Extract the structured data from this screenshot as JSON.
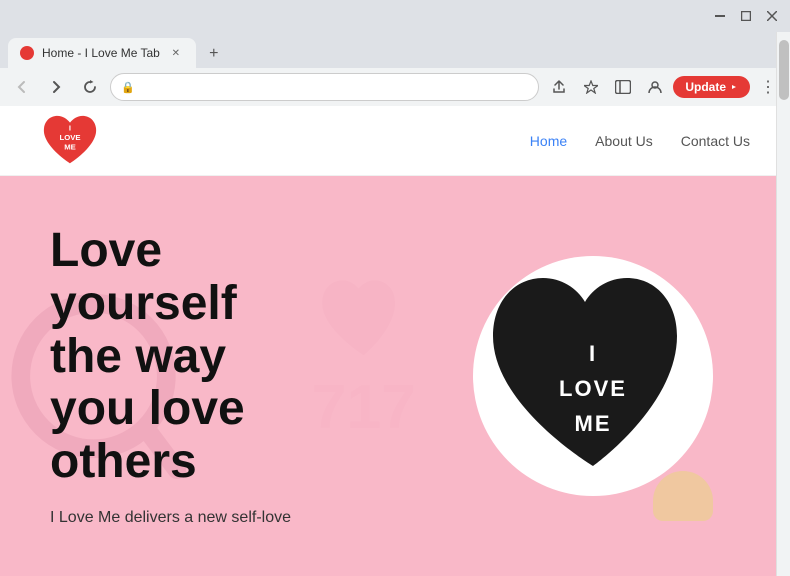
{
  "browser": {
    "title_bar": {
      "minimize_label": "—",
      "maximize_label": "❐",
      "close_label": "✕"
    },
    "tab": {
      "favicon_alt": "heart icon",
      "title": "Home - I Love Me Tab",
      "close_label": "✕"
    },
    "new_tab_label": "+",
    "nav": {
      "back_label": "←",
      "forward_label": "→",
      "refresh_label": "↻"
    },
    "url_bar": {
      "lock_icon": "🔒",
      "url": ""
    },
    "actions": {
      "share_label": "⬆",
      "bookmark_label": "☆",
      "sidebar_label": "▣",
      "profile_label": "👤",
      "update_label": "Update",
      "menu_label": "⋮"
    }
  },
  "website": {
    "nav": {
      "home_label": "Home",
      "about_label": "About Us",
      "contact_label": "Contact Us"
    },
    "logo": {
      "line1": "I",
      "line2": "LOVE",
      "line3": "ME"
    },
    "hero": {
      "heading_line1": "Love",
      "heading_line2": "yourself",
      "heading_line3": "the way",
      "heading_line4": "you love",
      "heading_line5": "others",
      "subtext": "I Love Me delivers a new self-love",
      "card_line1": "I",
      "card_line2": "LOVE",
      "card_line3": "ME"
    }
  }
}
